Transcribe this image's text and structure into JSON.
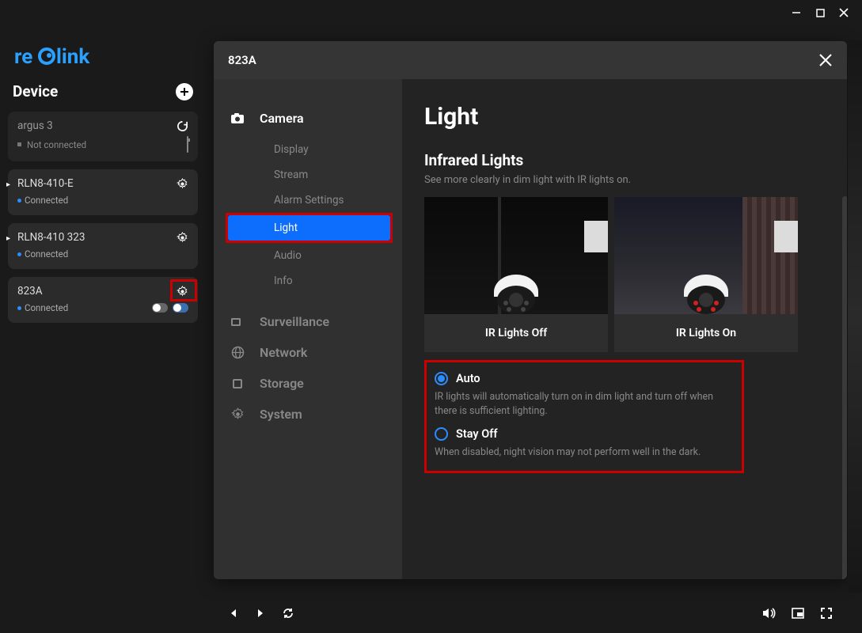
{
  "window": {
    "minimize": "–",
    "maximize": "▢",
    "close": "✕"
  },
  "brand": "reolink",
  "deviceHeader": {
    "title": "Device"
  },
  "devices": [
    {
      "name": "argus 3",
      "status": "Not connected",
      "connected": false
    },
    {
      "name": "RLN8-410-E",
      "status": "Connected",
      "connected": true
    },
    {
      "name": "RLN8-410 323",
      "status": "Connected",
      "connected": true
    },
    {
      "name": "823A",
      "status": "Connected",
      "connected": true
    }
  ],
  "overlay": {
    "title": "823A",
    "nav": {
      "camera": "Camera",
      "camera_items": [
        "Display",
        "Stream",
        "Alarm Settings",
        "Light",
        "Audio",
        "Info"
      ],
      "surveillance": "Surveillance",
      "network": "Network",
      "storage": "Storage",
      "system": "System"
    },
    "page": {
      "title": "Light",
      "section_title": "Infrared Lights",
      "section_desc": "See more clearly in dim light with IR lights on.",
      "preview_off": "IR Lights Off",
      "preview_on": "IR Lights On",
      "radio_auto": "Auto",
      "radio_auto_desc": "IR lights will automatically turn on in dim light and turn off when there is sufficient lighting.",
      "radio_stayoff": "Stay Off",
      "radio_stayoff_desc": "When disabled, night vision may not perform well in the dark."
    }
  }
}
